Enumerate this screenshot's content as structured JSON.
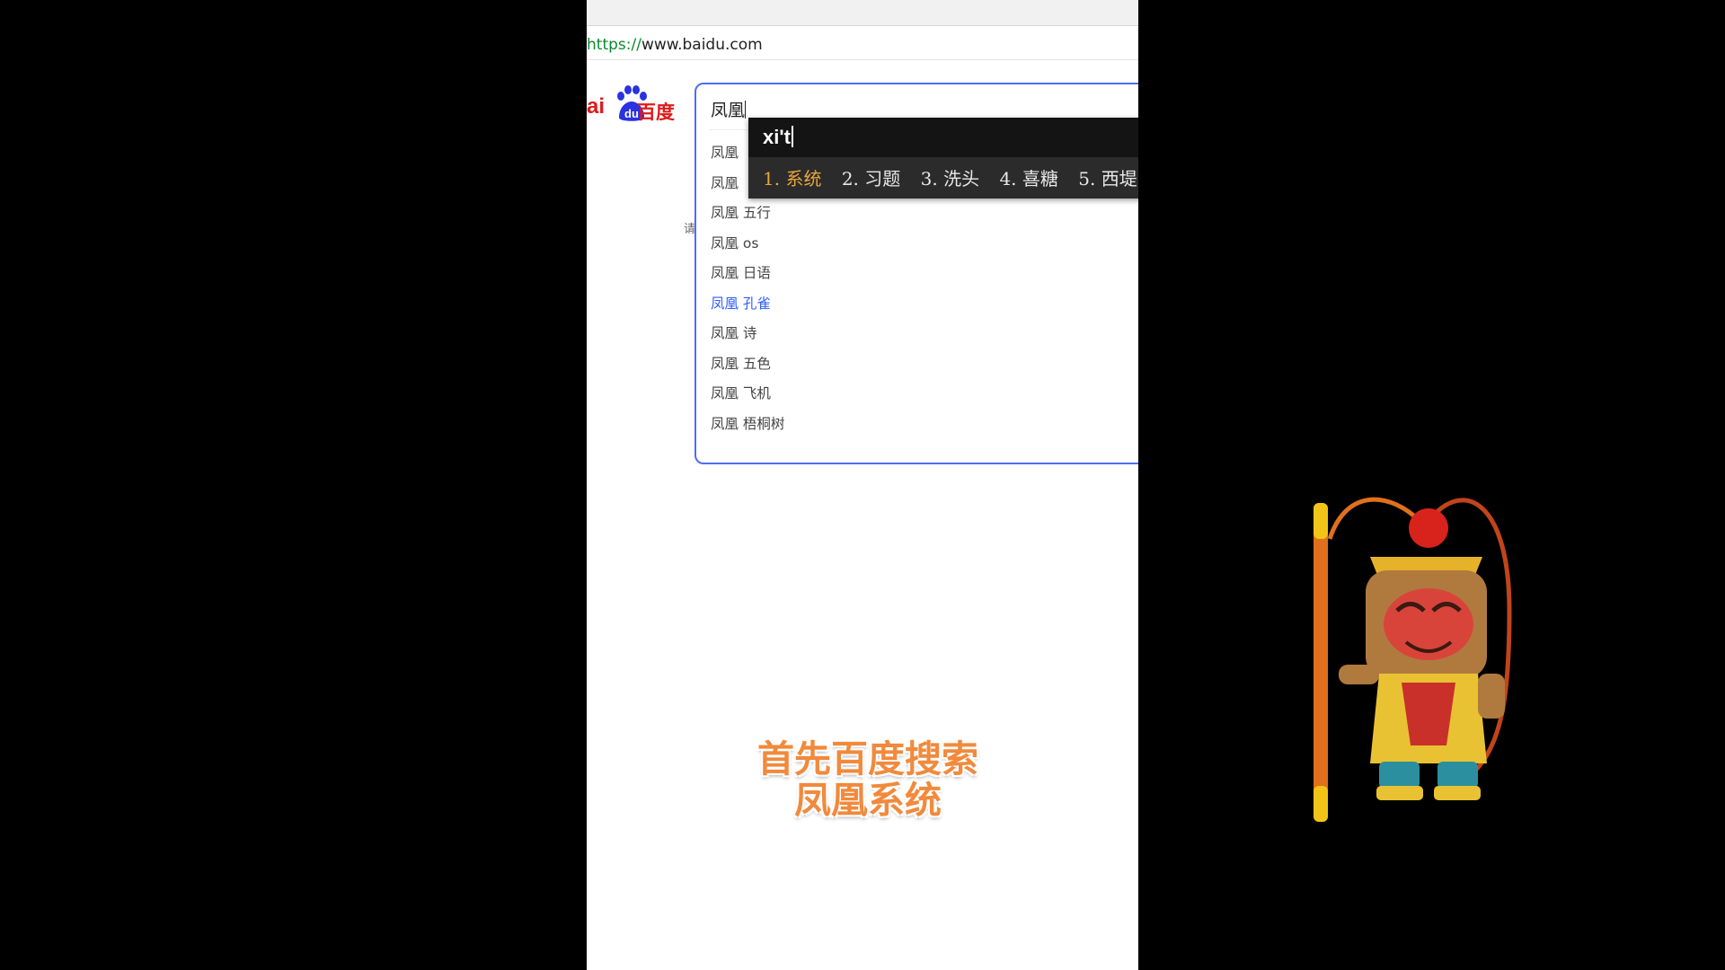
{
  "browser": {
    "url_scheme": "https://",
    "url_host": "www.baidu.com"
  },
  "logo": {
    "text_ai": "ai",
    "text_du": "du",
    "text_cn": "百度",
    "color": "#de1b1b",
    "paw_color": "#2932e1"
  },
  "side_hint": "请",
  "search": {
    "query": "凤凰",
    "suggestions": [
      "凤凰",
      "凤凰",
      "凤凰 五行",
      "凤凰 os",
      "凤凰 日语",
      "凤凰 孔雀",
      "凤凰 诗",
      "凤凰 五色",
      "凤凰 飞机",
      "凤凰 梧桐树"
    ],
    "active_index": 5
  },
  "ime": {
    "composition": "xi't",
    "candidates": [
      "1. 系统",
      "2. 习题",
      "3. 洗头",
      "4. 喜糖",
      "5. 西堤"
    ],
    "selected_color": "#e7a53a"
  },
  "caption": {
    "line1": "首先百度搜索",
    "line2": "凤凰系统",
    "color": "#f18a3c"
  },
  "mascot": {
    "icon": "monkey-king-icon"
  }
}
